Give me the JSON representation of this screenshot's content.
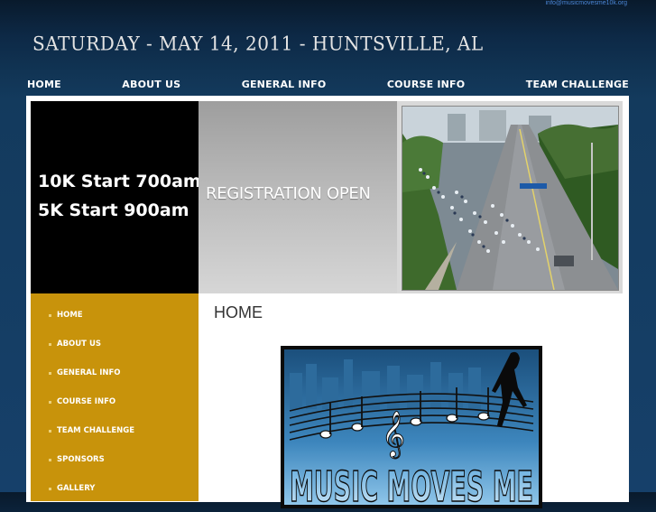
{
  "header": {
    "email": "info@musicmovesme10k.org",
    "event_line": "SATURDAY - MAY 14, 2011 - HUNTSVILLE, AL"
  },
  "top_nav": [
    "HOME",
    "ABOUT US",
    "GENERAL INFO",
    "COURSE INFO",
    "TEAM CHALLENGE"
  ],
  "banner": {
    "start_10k": "10K Start 700am",
    "start_5k": "5K Start 900am",
    "registration": "REGISTRATION OPEN"
  },
  "sidebar": {
    "items": [
      "HOME",
      "ABOUT US",
      "GENERAL INFO",
      "COURSE INFO",
      "TEAM CHALLENGE",
      "SPONSORS",
      "GALLERY"
    ]
  },
  "content": {
    "title": "HOME",
    "promo_text": "MUSIC MOVES ME"
  },
  "colors": {
    "sidebar_gold": "#c8930b",
    "header_blue": "#133a5d"
  }
}
